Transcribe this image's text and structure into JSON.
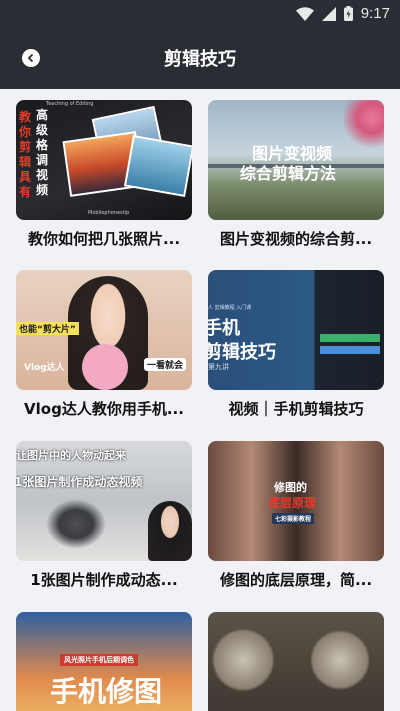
{
  "status_bar": {
    "time": "9:17"
  },
  "nav": {
    "title": "剪辑技巧"
  },
  "articles": [
    {
      "title": "教你如何把几张照片...",
      "thumb_text": {
        "top": "Teaching of Editing",
        "vertical": "教你剪辑具有",
        "vertical2": "高级格调视频",
        "bottom": "Mobilephonestip"
      }
    },
    {
      "title": "图片变视频的综合剪...",
      "thumb_text": {
        "line1": "图片变视频",
        "line2": "综合剪辑方法"
      }
    },
    {
      "title": "Vlog达人教你用手机...",
      "thumb_text": {
        "badge": "也能“剪大片”",
        "tag": "Vlog达人",
        "right": "一看就会"
      }
    },
    {
      "title": "视频｜手机剪辑技巧",
      "thumb_text": {
        "small": "人 剪辑教程 入门课",
        "line1": "手机",
        "line2": "剪辑技巧",
        "sub": "第九讲"
      }
    },
    {
      "title": "1张图片制作成动态...",
      "thumb_text": {
        "line1": "让图片中的人物动起来",
        "line2": "1张图片制作成动态视频"
      }
    },
    {
      "title": "修图的底层原理，简...",
      "thumb_text": {
        "line1": "修图的",
        "line2": "底层原理",
        "badge": "七彩摄影教程"
      }
    },
    {
      "title": "",
      "thumb_text": {
        "badge": "风光照片手机后期调色",
        "big": "手机修图"
      }
    },
    {
      "title": "",
      "thumb_text": {}
    }
  ],
  "colors": {
    "header_bg": "#2a2d33",
    "page_bg": "#f1f2f6"
  }
}
